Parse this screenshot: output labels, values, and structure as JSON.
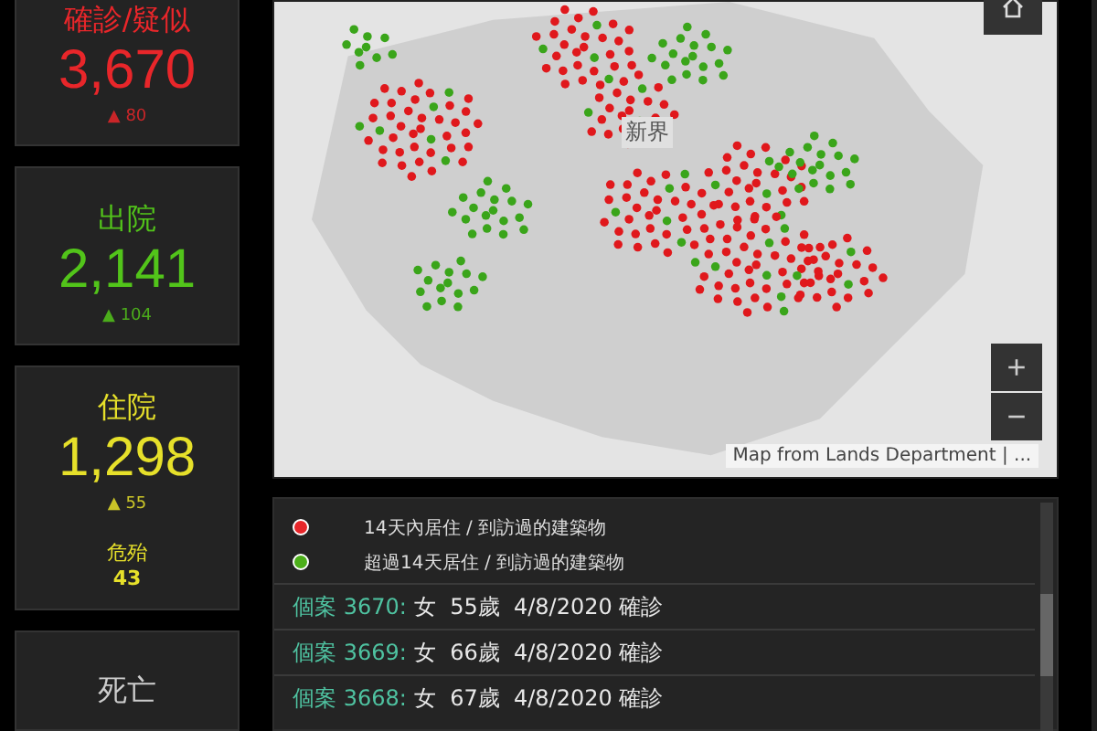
{
  "stats": [
    {
      "label": "確診/疑似",
      "value": "3,670",
      "delta": "▲ 80",
      "color": "#e8262a"
    },
    {
      "label": "出院",
      "value": "2,141",
      "delta": "▲ 104",
      "color": "#52c41a"
    },
    {
      "label": "住院",
      "value": "1,298",
      "delta": "▲ 55",
      "color": "#e6e02a",
      "sub": {
        "label": "危殆",
        "value": "43"
      }
    },
    {
      "label": "死亡",
      "color": "#cccccc"
    }
  ],
  "map": {
    "place_label": "新界",
    "zoom_in": "+",
    "zoom_out": "−",
    "attribution": "Map from Lands Department | ..."
  },
  "legend": [
    {
      "label": "14天內居住 / 到訪過的建築物",
      "color": "#e8262a"
    },
    {
      "label": "超過14天居住 / 到訪過的建築物",
      "color": "#4caf1a"
    }
  ],
  "cases": [
    {
      "case": "個案 3670:",
      "details": "女  55歲  4/8/2020 確診"
    },
    {
      "case": "個案 3669:",
      "details": "女  66歲  4/8/2020 確診"
    },
    {
      "case": "個案 3668:",
      "details": "女  67歲  4/8/2020 確診"
    }
  ]
}
